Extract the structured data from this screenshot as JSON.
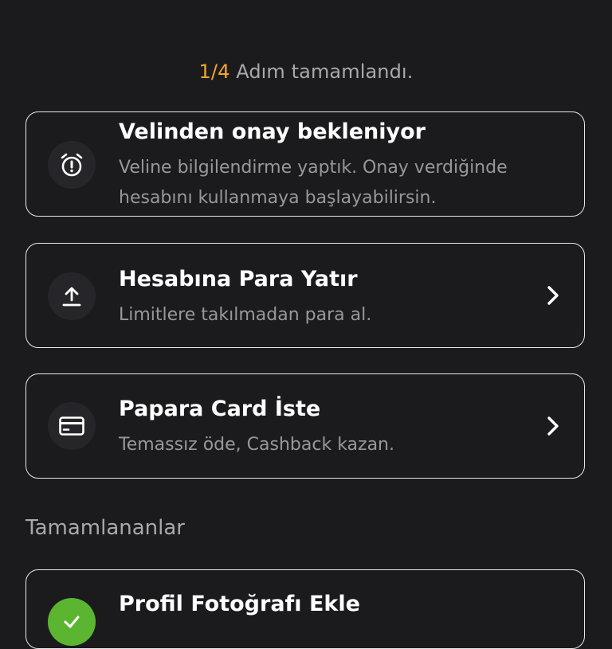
{
  "progress": {
    "count": "1/4",
    "text": "Adım tamamlandı."
  },
  "steps": [
    {
      "title": "Velinden onay bekleniyor",
      "description": "Veline bilgilendirme yaptık. Onay verdiğinde hesabını kullanmaya başlayabilirsin.",
      "icon": "alarm-clock-alert-icon"
    },
    {
      "title": "Hesabına Para Yatır",
      "description": "Limitlere takılmadan para al.",
      "icon": "upload-arrow-icon"
    },
    {
      "title": "Papara Card İste",
      "description": "Temassız öde, Cashback kazan.",
      "icon": "credit-card-icon"
    }
  ],
  "completed": {
    "label": "Tamamlananlar",
    "items": [
      {
        "title": "Profil Fotoğrafı Ekle",
        "icon": "check-icon"
      }
    ]
  },
  "colors": {
    "background": "#1b1b1d",
    "accent": "#f5a623",
    "success": "#5cb531",
    "border": "#e9e9ea",
    "muted_text": "#98989c"
  }
}
